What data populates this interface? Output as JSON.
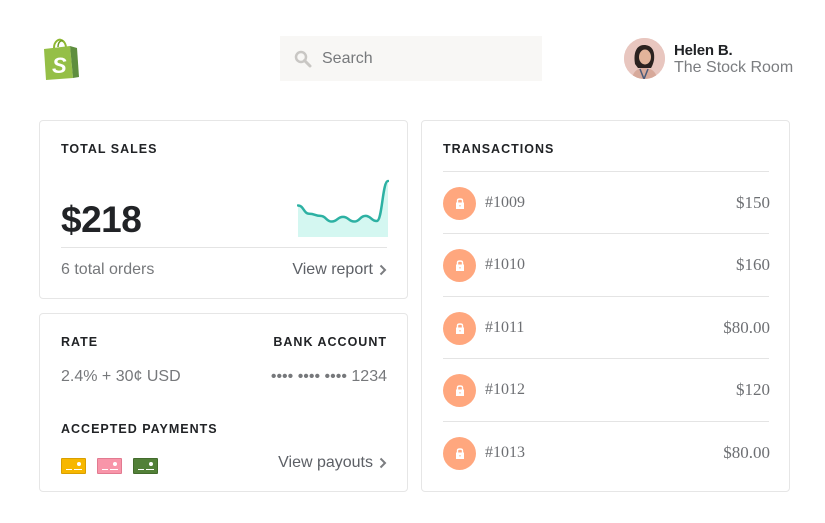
{
  "header": {
    "logo": "shopify-bag-logo",
    "search": {
      "placeholder": "Search",
      "value": "",
      "icon": "search-icon"
    },
    "user": {
      "name": "Helen B.",
      "store": "The Stock Room",
      "avatar": "avatar-photo"
    }
  },
  "total_sales": {
    "title": "TOTAL SALES",
    "amount": "$218",
    "orders": "6 total orders",
    "link": "View report",
    "sparkline": {
      "values": [
        0.53,
        0.37,
        0.33,
        0.22,
        0.31,
        0.22,
        0.33,
        0.23,
        1.0
      ],
      "color": "#2db1a3",
      "fill": "#d4f7f1"
    }
  },
  "payout_info": {
    "rate_label": "RATE",
    "rate_value": "2.4% + 30¢ USD",
    "bank_label": "BANK ACCOUNT",
    "bank_value": "•••• •••• •••• 1234",
    "accepted_label": "ACCEPTED PAYMENTS",
    "payment_methods": [
      {
        "name": "card-yellow",
        "color": "#f7b700",
        "border": "#d99f00"
      },
      {
        "name": "card-pink",
        "color": "#f895a9",
        "border": "#e27a90"
      },
      {
        "name": "card-green",
        "color": "#528038",
        "border": "#436b2c"
      }
    ],
    "link": "View payouts"
  },
  "transactions": {
    "title": "TRANSACTIONS",
    "badge_color": "#ffa77e",
    "items": [
      {
        "id": "#1009",
        "amount": "$150"
      },
      {
        "id": "#1010",
        "amount": "$160"
      },
      {
        "id": "#1011",
        "amount": "$80.00"
      },
      {
        "id": "#1012",
        "amount": "$120"
      },
      {
        "id": "#1013",
        "amount": "$80.00"
      }
    ]
  }
}
